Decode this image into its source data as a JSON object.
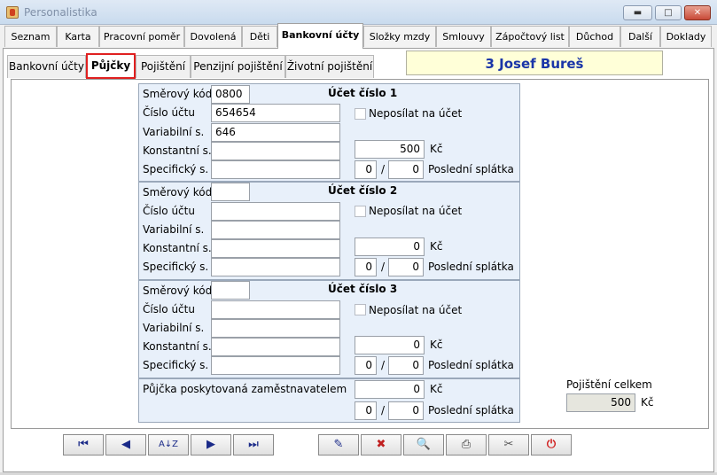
{
  "window": {
    "title": "Personalistika",
    "minimize": "▬",
    "maximize": "□",
    "close": "✕"
  },
  "main_tabs": [
    {
      "label": "Seznam"
    },
    {
      "label": "Karta"
    },
    {
      "label": "Pracovní poměr"
    },
    {
      "label": "Dovolená"
    },
    {
      "label": "Děti"
    },
    {
      "label": "Bankovní účty"
    },
    {
      "label": "Složky mzdy"
    },
    {
      "label": "Smlouvy"
    },
    {
      "label": "Zápočtový list"
    },
    {
      "label": "Důchod"
    },
    {
      "label": "Další"
    },
    {
      "label": "Doklady"
    }
  ],
  "active_main_tab": "Bankovní účty",
  "sub_tabs": [
    {
      "label": "Bankovní účty"
    },
    {
      "label": "Půjčky"
    },
    {
      "label": "Pojištění"
    },
    {
      "label": "Penzijní pojištění"
    },
    {
      "label": "Životní pojištění"
    }
  ],
  "active_sub_tab": "Půjčky",
  "employee": {
    "name": "3 Josef Bureš"
  },
  "labels": {
    "bank_code": "Směrový kód",
    "account_number": "Číslo účtu",
    "variable_symbol": "Variabilní s.",
    "constant_symbol": "Konstantní s.",
    "specific_symbol": "Specifický s.",
    "do_not_send": "Neposílat na účet",
    "currency": "Kč",
    "last_installment": "Poslední splátka",
    "slash": "/"
  },
  "accounts": [
    {
      "title": "Účet číslo 1",
      "bank_code": "0800",
      "account_number": "654654",
      "variable_symbol": "646",
      "constant_symbol": "",
      "specific_symbol": "",
      "amount": "500",
      "installment_from": "0",
      "installment_to": "0",
      "do_not_send": false
    },
    {
      "title": "Účet číslo 2",
      "bank_code": "",
      "account_number": "",
      "variable_symbol": "",
      "constant_symbol": "",
      "specific_symbol": "",
      "amount": "0",
      "installment_from": "0",
      "installment_to": "0",
      "do_not_send": false
    },
    {
      "title": "Účet číslo 3",
      "bank_code": "",
      "account_number": "",
      "variable_symbol": "",
      "constant_symbol": "",
      "specific_symbol": "",
      "amount": "0",
      "installment_from": "0",
      "installment_to": "0",
      "do_not_send": false
    }
  ],
  "employer_loan": {
    "label": "Půjčka poskytovaná zaměstnavatelem",
    "amount": "0",
    "installment_from": "0",
    "installment_to": "0"
  },
  "insurance_total": {
    "label": "Pojištění celkem",
    "value": "500",
    "currency": "Kč"
  },
  "toolbar": [
    {
      "icon": "first-record-icon",
      "glyph": "⏮"
    },
    {
      "icon": "previous-record-icon",
      "glyph": "◀"
    },
    {
      "icon": "sort-az-icon",
      "glyph": "A↓Z"
    },
    {
      "icon": "next-record-icon",
      "glyph": "▶"
    },
    {
      "icon": "last-record-icon",
      "glyph": "⏭"
    },
    {
      "icon": "edit-record-icon",
      "glyph": "✎"
    },
    {
      "icon": "delete-record-icon",
      "glyph": "✖"
    },
    {
      "icon": "search-record-icon",
      "glyph": "🔍"
    },
    {
      "icon": "print-icon",
      "glyph": "⎙"
    },
    {
      "icon": "tools-icon",
      "glyph": "✂"
    },
    {
      "icon": "power-icon",
      "glyph": "⏻"
    }
  ]
}
